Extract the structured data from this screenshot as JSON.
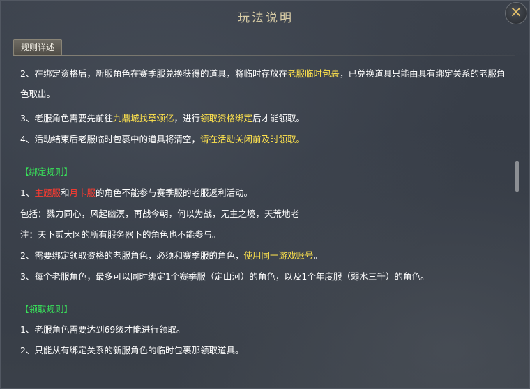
{
  "title": "玩法说明",
  "close_icon": "×",
  "tab_label": "规则详述",
  "para1": {
    "a": "2、在绑定资格后，新服角色在赛季服兑换获得的道具，将临时存放在",
    "b": "老服临时包裹",
    "c": "，已兑换道具只能由具有绑定关系的老服角色取出。"
  },
  "para2": {
    "a": "3、老服角色需要先前往",
    "b": "九鼎城找草颂亿",
    "c": "，进行",
    "d": "领取资格绑定",
    "e": "后才能领取。"
  },
  "para3": {
    "a": "4、活动结束后老服临时包裹中的道具将清空，",
    "b": "请在活动关闭前及时领取。"
  },
  "section_bind": "【绑定规则】",
  "bind1": {
    "a": "1、",
    "b": "主题服",
    "c": "和",
    "d": "月卡服",
    "e": "的角色不能参与赛季服的老服返利活动。"
  },
  "bind_include": "包括：戮力同心，风起幽溟，再战今朝，何以为战，无主之境，天荒地老",
  "bind_note": "注：天下贰大区的所有服务器下的角色也不能参与。",
  "bind2": {
    "a": "2、需要绑定领取资格的老服角色，必须和赛季服的角色，",
    "b": "使用同一游戏账号",
    "c": "。"
  },
  "bind3": "3、每个老服角色，最多可以同时绑定1个赛季服（定山河）的角色，以及1个年度服（弱水三千）的角色。",
  "section_claim": "【领取规则】",
  "claim1": "1、老服角色需要达到69级才能进行领取。",
  "claim2": "2、只能从有绑定关系的新服角色的临时包裹那领取道具。",
  "colors": {
    "title": "#d9cda6",
    "highlight_yellow": "#ffe34d",
    "section_green": "#39e05a",
    "highlight_red": "#ff3b30",
    "close_icon": "#e8c36a"
  }
}
